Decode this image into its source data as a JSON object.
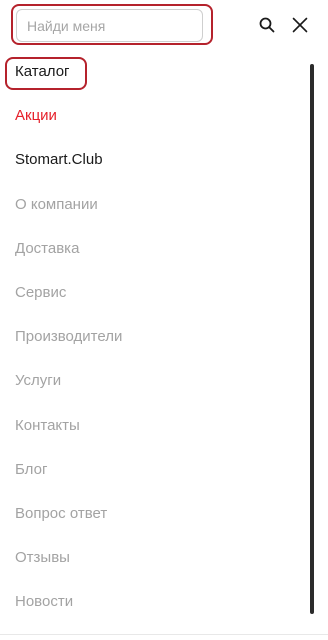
{
  "search": {
    "placeholder": "Найди меня",
    "value": "",
    "search_icon": "search-icon",
    "close_icon": "close-icon"
  },
  "menu": {
    "items": [
      {
        "label": "Каталог",
        "style": "primary"
      },
      {
        "label": "Акции",
        "style": "accent"
      },
      {
        "label": "Stomart.Club",
        "style": "primary"
      },
      {
        "label": "О компании",
        "style": "muted"
      },
      {
        "label": "Доставка",
        "style": "muted"
      },
      {
        "label": "Сервис",
        "style": "muted"
      },
      {
        "label": "Производители",
        "style": "muted"
      },
      {
        "label": "Услуги",
        "style": "muted"
      },
      {
        "label": "Контакты",
        "style": "muted"
      },
      {
        "label": "Блог",
        "style": "muted"
      },
      {
        "label": "Вопрос ответ",
        "style": "muted"
      },
      {
        "label": "Отзывы",
        "style": "muted"
      },
      {
        "label": "Новости",
        "style": "muted"
      }
    ]
  },
  "colors": {
    "accent": "#e6202a",
    "primary_text": "#1a1a1a",
    "muted_text": "#a3a3a3",
    "highlight_border": "#b5222c"
  }
}
